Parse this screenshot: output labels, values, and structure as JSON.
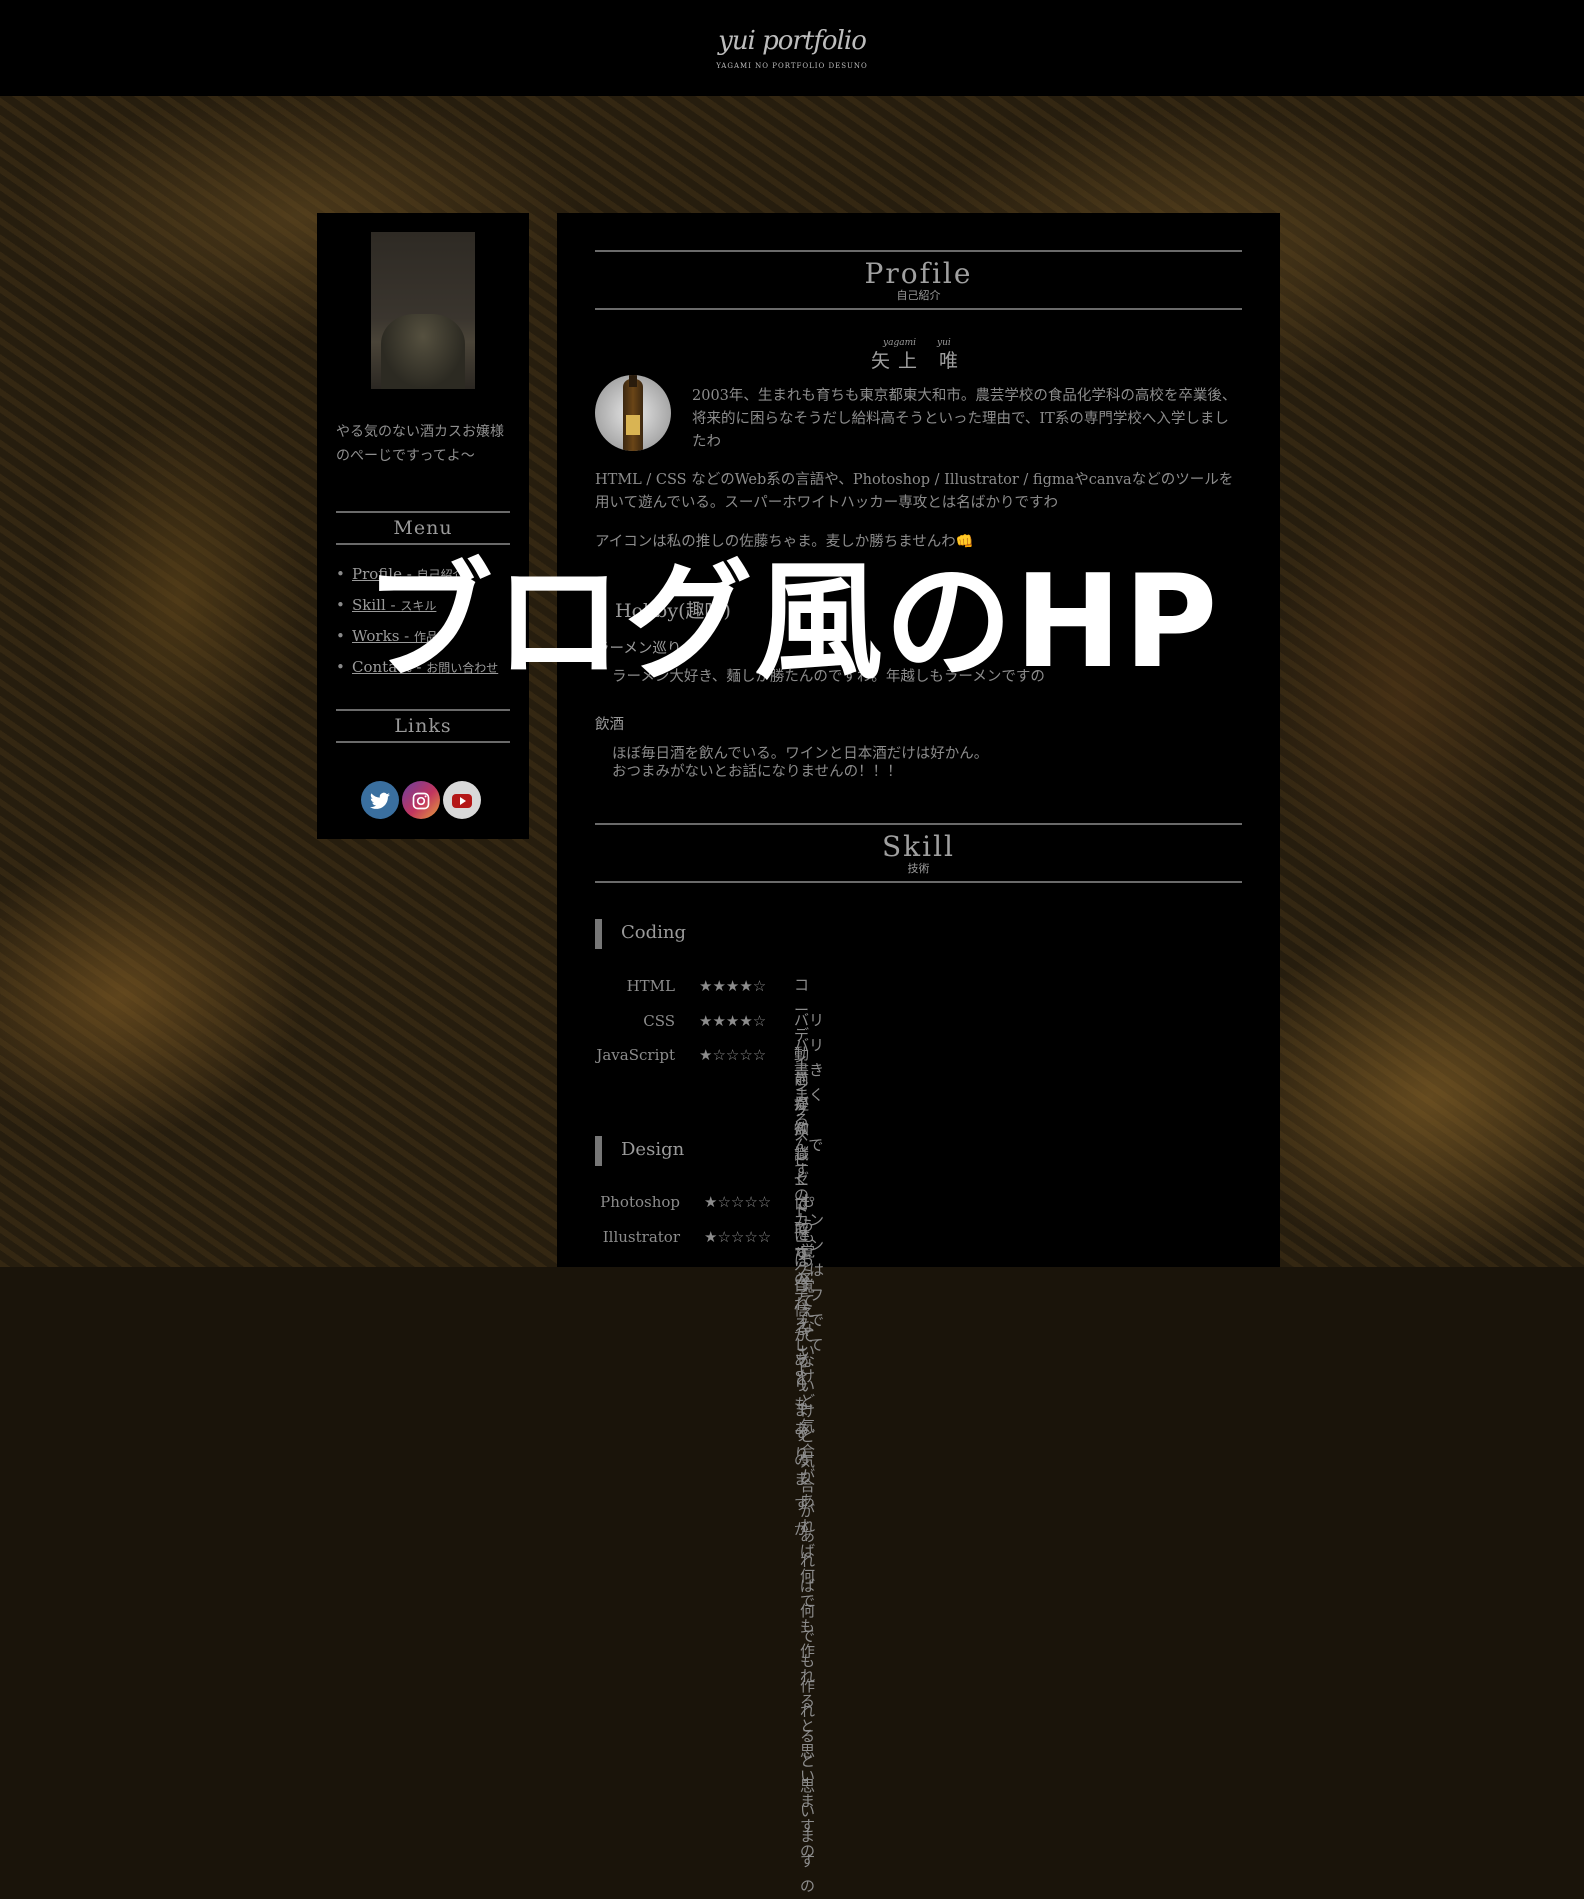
{
  "header": {
    "logo_script": "yui portfolio",
    "logo_sub": "YAGAMI NO PORTFOLIO DESUNO"
  },
  "sidebar": {
    "tagline": "やる気のない酒カスお嬢様のぺーじですってよ〜",
    "menu_title": "Menu",
    "menu": [
      {
        "en": "Profile - ",
        "jp": "自己紹介"
      },
      {
        "en": "Skill - ",
        "jp": "スキル"
      },
      {
        "en": "Works - ",
        "jp": "作品"
      },
      {
        "en": "Contact - ",
        "jp": "お問い合わせ"
      }
    ],
    "links_title": "Links",
    "social": [
      "twitter-icon",
      "instagram-icon",
      "youtube-icon"
    ]
  },
  "profile": {
    "title_en": "Profile",
    "title_jp": "自己紹介",
    "ruby_last": "yagami",
    "ruby_first": "yui",
    "name": "矢上 唯",
    "bio1": "2003年、生まれも育ちも東京都東大和市。農芸学校の食品化学科の高校を卒業後、将来的に困らなそうだし給料高そうといった理由で、IT系の専門学校へ入学しましたわ",
    "bio2": "HTML / CSS などのWeb系の言語や、Photoshop / Illustrator / figmaやcanvaなどのツールを用いて遊んでいる。スーパーホワイトハッカー専攻とは名ばかりですわ",
    "bio3": "アイコンは私の推しの佐藤ちゃま。麦しか勝ちませんわ👊",
    "hobby_title": "Hobby(趣味)",
    "hobbies": [
      {
        "title": "ラーメン巡り",
        "body": "ラーメン大好き、麺しか勝たんのですわ。年越しもラーメンですの"
      },
      {
        "title": "飲酒",
        "body": "ほぼ毎日酒を飲んでいる。ワインと日本酒だけは好かん。",
        "body2": "おつまみがないとお話になりませんの！！！"
      }
    ]
  },
  "skill": {
    "title_en": "Skill",
    "title_jp": "技術",
    "coding_title": "Coding",
    "coding": [
      {
        "name": "HTML",
        "stars": "★★★★☆",
        "desc": "コーディングスピードには自信がありますの",
        "rating": 4
      },
      {
        "name": "CSS",
        "stars": "★★★★☆",
        "desc": "バリバリ書きまくるんですの。カンニングはデフォでしてよ",
        "rating": 4
      },
      {
        "name": "JavaScript",
        "stars": "★☆☆☆☆",
        "desc": "動きが欲しくて取り入れることもありますが",
        "desc2": "前提知識ゼロですの",
        "rating": 1
      }
    ],
    "design_title": "Design",
    "design": [
      {
        "name": "Photoshop",
        "stars": "★☆☆☆☆",
        "desc": "もう覚えてないけど気合があれば何でも作れると思いますの",
        "rating": 1
      },
      {
        "name": "Illustrator",
        "stars": "★☆☆☆☆",
        "desc": "もう覚えてないけど気合があれば何でも作れると思いますの",
        "rating": 1
      }
    ]
  },
  "overlay": {
    "title": "ブログ風のHP"
  }
}
